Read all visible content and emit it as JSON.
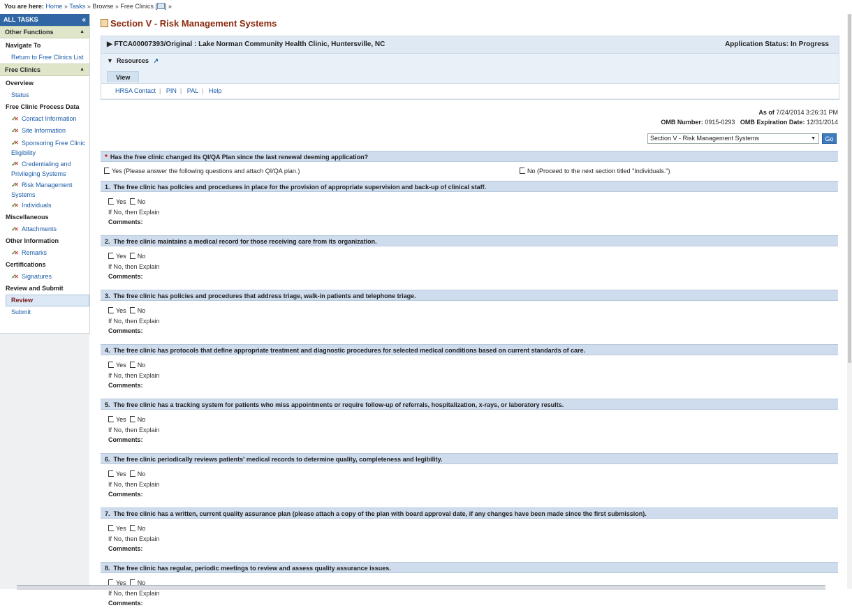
{
  "breadcrumb": {
    "prefix": "You are here:",
    "home": "Home",
    "tasks": "Tasks",
    "browse": "Browse",
    "current": "Free Clinics [",
    "suffix": "] »",
    "sep": "»"
  },
  "sidebar": {
    "header": "ALL TASKS",
    "collapse_glyph": "«",
    "other_functions": "Other Functions",
    "navigate_to": "Navigate To",
    "return_link": "Return to Free Clinics List",
    "free_clinics": "Free Clinics",
    "overview": "Overview",
    "status": "Status",
    "process_data": "Free Clinic Process Data",
    "items": {
      "contact": "Contact Information",
      "site": "Site Information",
      "sponsoring_a": "Sponsoring Free Clinic",
      "sponsoring_b": "Eligibility",
      "cred_a": "Credentialing and",
      "cred_b": "Privileging Systems",
      "risk_a": "Risk Management",
      "risk_b": "Systems",
      "individuals": "Individuals"
    },
    "misc": "Miscellaneous",
    "attachments": "Attachments",
    "other_info": "Other Information",
    "remarks": "Remarks",
    "certs": "Certifications",
    "signatures": "Signatures",
    "review_submit": "Review and Submit",
    "review": "Review",
    "submit": "Submit"
  },
  "page": {
    "title": "Section V - Risk Management Systems",
    "app_line": "FTCA00007393/Original : Lake Norman Community Health Clinic, Huntersville, NC",
    "app_status": "Application Status: In Progress",
    "resources": "Resources",
    "view_tab": "View",
    "links": [
      "HRSA Contact",
      "PIN",
      "PAL",
      "Help"
    ],
    "as_of_label": "As of",
    "as_of_value": "7/24/2014 3:26:31 PM",
    "omb_label": "OMB Number:",
    "omb_value": "0915-0293",
    "omb_exp_label": "OMB Expiration Date:",
    "omb_exp_value": "12/31/2014",
    "section_select": "Section V - Risk Management Systems",
    "go": "Go"
  },
  "top_question": {
    "text": "Has the free clinic changed its QI/QA Plan since the last renewal deeming application?",
    "yes": "Yes (Please answer the following questions and attach QI/QA plan.)",
    "no": "No (Proceed to the next section titled \"Individuals.\")"
  },
  "questions": [
    {
      "n": "1.",
      "text": "The free clinic has policies and procedures in place for the provision of appropriate supervision and back-up of clinical staff."
    },
    {
      "n": "2.",
      "text": "The free clinic maintains a medical record for those receiving care from its organization."
    },
    {
      "n": "3.",
      "text": "The free clinic has policies and procedures that address triage, walk-in patients and telephone triage."
    },
    {
      "n": "4.",
      "text": "The free clinic has protocols that define appropriate treatment and diagnostic procedures for selected medical conditions based on current standards of care."
    },
    {
      "n": "5.",
      "text": "The free clinic has a tracking system for patients who miss appointments or require follow-up of referrals, hospitalization, x-rays, or laboratory results."
    },
    {
      "n": "6.",
      "text": "The free clinic periodically reviews patients' medical records to determine quality, completeness and legibility."
    },
    {
      "n": "7.",
      "text": "The free clinic has a written, current quality assurance plan (please attach a copy of the plan with board approval date, if any changes have been made since the first submission)."
    },
    {
      "n": "8.",
      "text": "The free clinic has regular, periodic meetings to review and assess quality assurance issues."
    }
  ],
  "labels": {
    "yes": "Yes",
    "no": "No",
    "explain": "If No, then Explain",
    "comments": "Comments:"
  }
}
